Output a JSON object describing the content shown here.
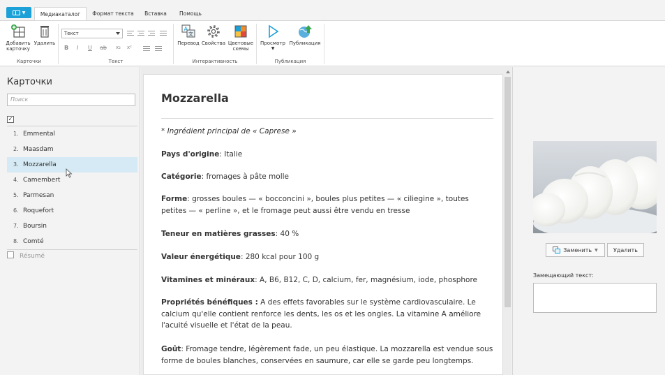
{
  "tabs": {
    "items": [
      "Медиакаталог",
      "Формат текста",
      "Вставка",
      "Помощь"
    ],
    "active": "Медиакаталог"
  },
  "ribbon": {
    "cards_group": {
      "label": "Карточки",
      "add": "Добавить карточку",
      "delete": "Удалить"
    },
    "text_group": {
      "label": "Текст",
      "font_value": "Текст"
    },
    "interactivity_group": {
      "label": "Интерактивность",
      "translate": "Перевод",
      "properties": "Свойства",
      "color_schemes": "Цветовые схемы"
    },
    "publish_group": {
      "label": "Публикация",
      "preview": "Просмотр",
      "publish": "Публикация"
    }
  },
  "sidebar": {
    "title": "Карточки",
    "search_placeholder": "Поиск",
    "items": [
      {
        "num": "1.",
        "label": "Emmental"
      },
      {
        "num": "2.",
        "label": "Maasdam"
      },
      {
        "num": "3.",
        "label": "Mozzarella"
      },
      {
        "num": "4.",
        "label": "Camembert"
      },
      {
        "num": "5.",
        "label": "Parmesan"
      },
      {
        "num": "6.",
        "label": "Roquefort"
      },
      {
        "num": "7.",
        "label": "Boursin"
      },
      {
        "num": "8.",
        "label": "Comté"
      }
    ],
    "selected": "Mozzarella",
    "summary": "Résumé"
  },
  "document": {
    "title": "Mozzarella",
    "subtitle": "* Ingrédient principal de « Caprese »",
    "fields": [
      {
        "label": "Pays d'origine",
        "sep": ":",
        "value": " Italie"
      },
      {
        "label": "Catégorie",
        "sep": ":",
        "value": " fromages à pâte molle"
      },
      {
        "label": "Forme",
        "sep": ":",
        "value": " grosses boules — « bocconcini », boules plus petites — « ciliegine », toutes petites — « perline », et le fromage peut aussi être vendu en tresse"
      },
      {
        "label": "Teneur en matières grasses",
        "sep": ":",
        "value": " 40 %"
      },
      {
        "label": "Valeur énergétique",
        "sep": ":",
        "value": " 280 kcal pour 100 g"
      },
      {
        "label": "Vitamines et minéraux",
        "sep": ":",
        "value": " A, B6, B12, C, D, calcium, fer, magnésium, iode, phosphore"
      },
      {
        "label": "Propriétés bénéfiques :",
        "sep": "",
        "value": " A des effets favorables sur le système cardiovasculaire. Le calcium qu'elle contient renforce les dents, les os et les ongles. La vitamine A améliore l'acuité visuelle et l'état de la peau."
      },
      {
        "label": "Goût",
        "sep": ":",
        "value": " Fromage tendre, légèrement fade, un peu élastique. La mozzarella est vendue sous forme de boules blanches, conservées en saumure, car elle se garde peu longtemps."
      }
    ]
  },
  "image_panel": {
    "replace": "Заменить",
    "delete": "Удалить",
    "alt_label": "Замещающий текст:",
    "alt_value": ""
  },
  "colors": {
    "accent": "#1ba0d8",
    "selected_row": "#d5eaf4"
  }
}
